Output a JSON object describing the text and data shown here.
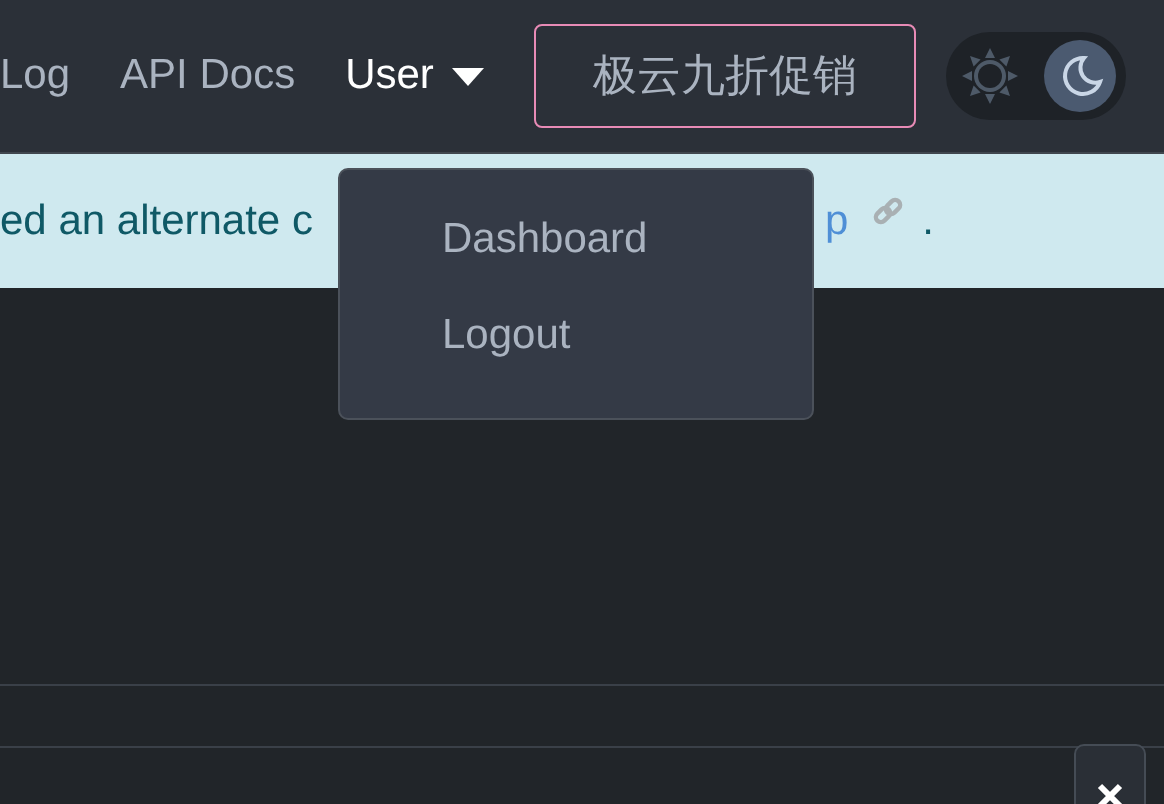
{
  "navbar": {
    "items": [
      {
        "label": "Log",
        "active": false,
        "dropdown": false
      },
      {
        "label": "API Docs",
        "active": false,
        "dropdown": false
      },
      {
        "label": "User",
        "active": true,
        "dropdown": true
      }
    ],
    "promo_button": "极云九折促销",
    "theme_toggle": [
      {
        "kind": "light",
        "selected": false
      },
      {
        "kind": "dark",
        "selected": true
      }
    ]
  },
  "alert": {
    "text": "ed an alternate c",
    "link": "p",
    "after": "."
  },
  "dropdown_menu": {
    "items": [
      "Dashboard",
      "Logout"
    ]
  }
}
